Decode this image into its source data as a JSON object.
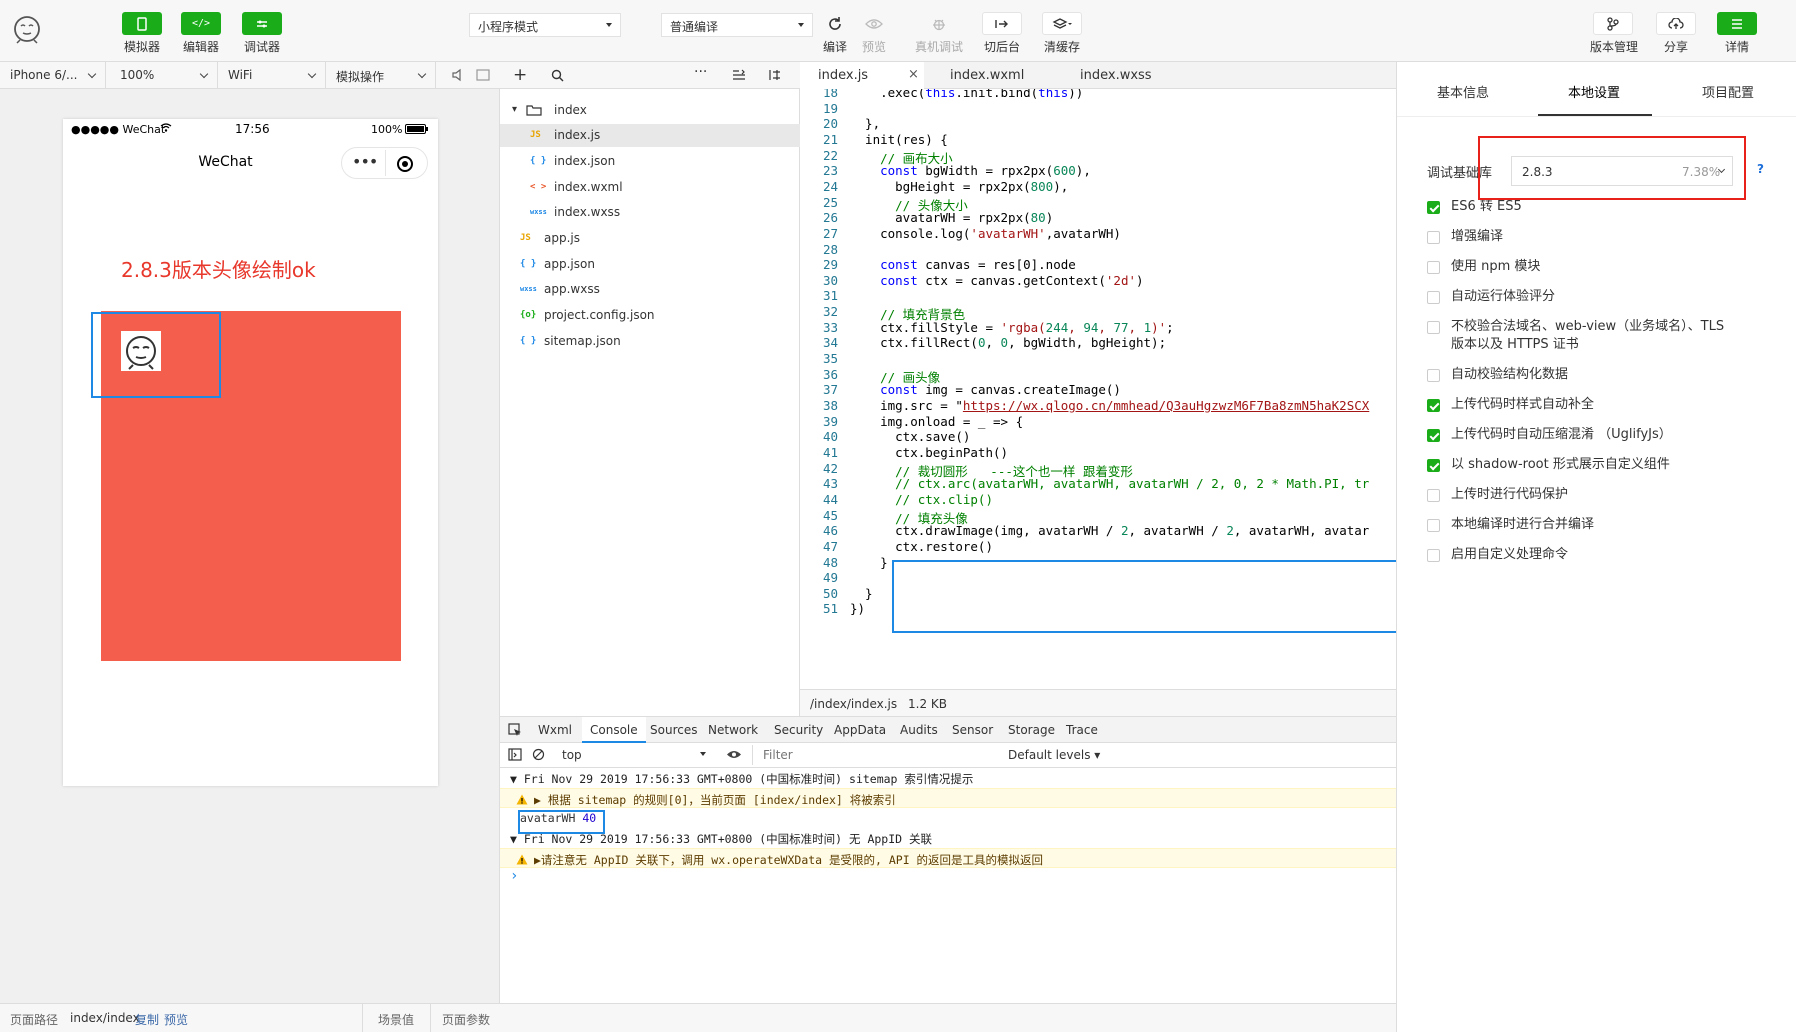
{
  "toolbar": {
    "simulator": "模拟器",
    "editor": "编辑器",
    "debugger": "调试器",
    "mode_select": "小程序模式",
    "compile_select": "普通编译",
    "compile": "编译",
    "preview": "预览",
    "remote_debug": "真机调试",
    "background": "切后台",
    "clear_cache": "清缓存",
    "version_mgmt": "版本管理",
    "share": "分享",
    "details": "详情"
  },
  "sim_options": {
    "device": "iPhone 6/...",
    "zoom": "100%",
    "network": "WiFi",
    "operation": "模拟操作"
  },
  "phone": {
    "signal": "●●●●● WeChat",
    "time": "17:56",
    "battery": "100%",
    "title": "WeChat",
    "overlay_text": "2.8.3版本头像绘制ok"
  },
  "bottom": {
    "path_label": "页面路径",
    "path": "index/index",
    "copy": "复制",
    "preview": "预览",
    "scene": "场景值",
    "params": "页面参数"
  },
  "file_tree": [
    {
      "name": "index",
      "icon": "folder",
      "level": 0
    },
    {
      "name": "index.js",
      "icon": "JS",
      "level": 2,
      "selected": true
    },
    {
      "name": "index.json",
      "icon": "{ }",
      "level": 2
    },
    {
      "name": "index.wxml",
      "icon": "< >",
      "level": 2
    },
    {
      "name": "index.wxss",
      "icon": "wxss",
      "level": 2
    },
    {
      "name": "app.js",
      "icon": "JS",
      "level": 1
    },
    {
      "name": "app.json",
      "icon": "{ }",
      "level": 1
    },
    {
      "name": "app.wxss",
      "icon": "wxss",
      "level": 1
    },
    {
      "name": "project.config.json",
      "icon": "{o}",
      "level": 1
    },
    {
      "name": "sitemap.json",
      "icon": "{ }",
      "level": 1
    }
  ],
  "editor": {
    "tabs": [
      "index.js",
      "index.wxml",
      "index.wxss"
    ],
    "status_path": "/index/index.js",
    "status_size": "1.2 KB",
    "lines": [
      {
        "n": "18",
        "t": "    .exec(this.init.bind(this))",
        "c": ""
      },
      {
        "n": "19",
        "t": "",
        "c": ""
      },
      {
        "n": "20",
        "t": "  },",
        "c": ""
      },
      {
        "n": "21",
        "t": "  init(res) {",
        "c": ""
      },
      {
        "n": "22",
        "t": "    // 画布大小",
        "c": "cm"
      },
      {
        "n": "23",
        "t": "    const bgWidth = rpx2px(600),",
        "c": ""
      },
      {
        "n": "24",
        "t": "      bgHeight = rpx2px(800),",
        "c": ""
      },
      {
        "n": "25",
        "t": "      // 头像大小",
        "c": "cm"
      },
      {
        "n": "26",
        "t": "      avatarWH = rpx2px(80)",
        "c": ""
      },
      {
        "n": "27",
        "t": "    console.log('avatarWH',avatarWH)",
        "c": ""
      },
      {
        "n": "28",
        "t": "",
        "c": ""
      },
      {
        "n": "29",
        "t": "    const canvas = res[0].node",
        "c": ""
      },
      {
        "n": "30",
        "t": "    const ctx = canvas.getContext('2d')",
        "c": ""
      },
      {
        "n": "31",
        "t": "",
        "c": ""
      },
      {
        "n": "32",
        "t": "    // 填充背景色",
        "c": "cm"
      },
      {
        "n": "33",
        "t": "    ctx.fillStyle = 'rgba(244, 94, 77, 1)';",
        "c": ""
      },
      {
        "n": "34",
        "t": "    ctx.fillRect(0, 0, bgWidth, bgHeight);",
        "c": ""
      },
      {
        "n": "35",
        "t": "",
        "c": ""
      },
      {
        "n": "36",
        "t": "    // 画头像",
        "c": "cm"
      },
      {
        "n": "37",
        "t": "    const img = canvas.createImage()",
        "c": ""
      },
      {
        "n": "38",
        "t": "    img.src = \"https://wx.qlogo.cn/mmhead/Q3auHgzwzM6F7Ba8zmN5haK2SCX",
        "c": ""
      },
      {
        "n": "39",
        "t": "    img.onload = _ => {",
        "c": ""
      },
      {
        "n": "40",
        "t": "      ctx.save()",
        "c": ""
      },
      {
        "n": "41",
        "t": "      ctx.beginPath()",
        "c": ""
      },
      {
        "n": "42",
        "t": "      // 裁切圆形   ---这个也一样 跟着变形",
        "c": "cm"
      },
      {
        "n": "43",
        "t": "      // ctx.arc(avatarWH, avatarWH, avatarWH / 2, 0, 2 * Math.PI, tr",
        "c": "cm"
      },
      {
        "n": "44",
        "t": "      // ctx.clip()",
        "c": "cm"
      },
      {
        "n": "45",
        "t": "      // 填充头像",
        "c": "cm"
      },
      {
        "n": "46",
        "t": "      ctx.drawImage(img, avatarWH / 2, avatarWH / 2, avatarWH, avatar",
        "c": ""
      },
      {
        "n": "47",
        "t": "      ctx.restore()",
        "c": ""
      },
      {
        "n": "48",
        "t": "    }",
        "c": ""
      },
      {
        "n": "49",
        "t": "",
        "c": ""
      },
      {
        "n": "50",
        "t": "  }",
        "c": ""
      },
      {
        "n": "51",
        "t": "})",
        "c": ""
      }
    ]
  },
  "devtools": {
    "tabs": [
      "Wxml",
      "Console",
      "Sources",
      "Network",
      "Security",
      "AppData",
      "Audits",
      "Sensor",
      "Storage",
      "Trace"
    ],
    "active_tab": "Console",
    "context": "top",
    "filter_placeholder": "Filter",
    "levels": "Default levels"
  },
  "console": [
    {
      "type": "group",
      "text": "▼ Fri Nov 29 2019 17:56:33 GMT+0800 (中国标准时间) sitemap 索引情况提示"
    },
    {
      "type": "warn",
      "text": "▶ 根据 sitemap 的规则[0]，当前页面 [index/index] 将被索引"
    },
    {
      "type": "log",
      "text": "avatarWH 40"
    },
    {
      "type": "group",
      "text": "▼ Fri Nov 29 2019 17:56:33 GMT+0800 (中国标准时间) 无 AppID 关联"
    },
    {
      "type": "warn",
      "text": "▶请注意无 AppID 关联下，调用 wx.operateWXData 是受限的, API 的返回是工具的模拟返回"
    },
    {
      "type": "prompt",
      "text": "›"
    }
  ],
  "settings": {
    "tabs": [
      "基本信息",
      "本地设置",
      "项目配置"
    ],
    "active_tab": "本地设置",
    "lib_label": "调试基础库",
    "lib_version": "2.8.3",
    "lib_percent": "7.38%",
    "help": "?",
    "options": [
      {
        "label": "ES6 转 ES5",
        "checked": true
      },
      {
        "label": "增强编译",
        "checked": false
      },
      {
        "label": "使用 npm 模块",
        "checked": false
      },
      {
        "label": "自动运行体验评分",
        "checked": false
      },
      {
        "label": "不校验合法域名、web-view（业务域名）、TLS 版本以及 HTTPS 证书",
        "checked": false
      },
      {
        "label": "自动校验结构化数据",
        "checked": false
      },
      {
        "label": "上传代码时样式自动补全",
        "checked": true
      },
      {
        "label": "上传代码时自动压缩混淆 （UglifyJs）",
        "checked": true
      },
      {
        "label": "以 shadow-root 形式展示自定义组件",
        "checked": true
      },
      {
        "label": "上传时进行代码保护",
        "checked": false
      },
      {
        "label": "本地编译时进行合并编译",
        "checked": false
      },
      {
        "label": "启用自定义处理命令",
        "checked": false
      }
    ]
  },
  "colors": {
    "brand_green": "#1aad19",
    "canvas_fill": "#f45e4d",
    "highlight_blue": "#1e88e5",
    "highlight_red": "#e8221b"
  }
}
